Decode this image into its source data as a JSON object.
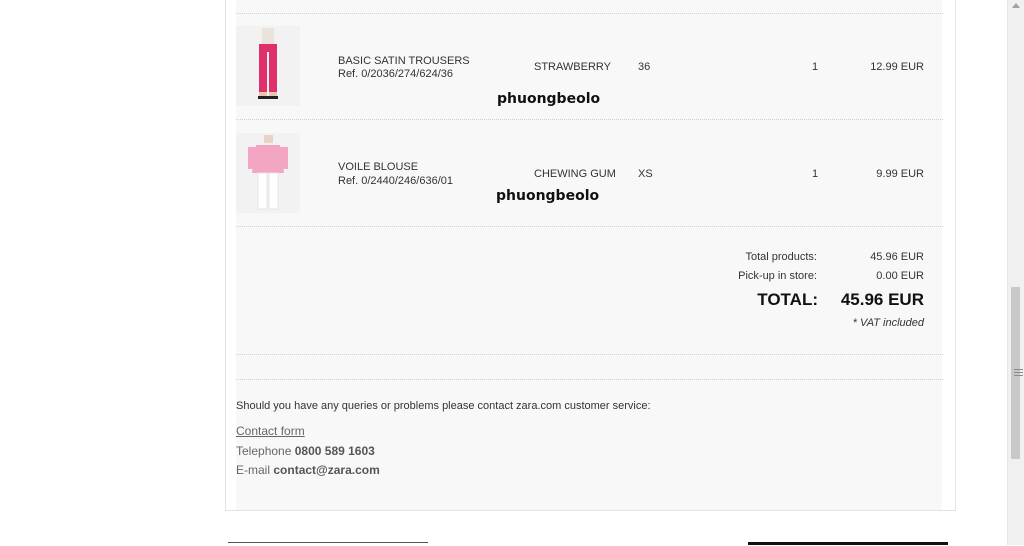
{
  "order": {
    "items": [
      {
        "name": "BASIC SATIN TROUSERS",
        "ref": "Ref. 0/2036/274/624/36",
        "color": "STRAWBERRY",
        "size": "36",
        "quantity": "1",
        "price": "12.99 EUR",
        "watermark": "phuongbeolo",
        "image": "trousers-product-image"
      },
      {
        "name": "VOILE BLOUSE",
        "ref": "Ref. 0/2440/246/636/01",
        "color": "CHEWING GUM",
        "size": "XS",
        "quantity": "1",
        "price": "9.99 EUR",
        "watermark": "phuongbeolo",
        "image": "blouse-product-image"
      }
    ],
    "totals": {
      "products_label": "Total products:",
      "products_value": "45.96 EUR",
      "pickup_label": "Pick-up in store:",
      "pickup_value": "0.00 EUR",
      "total_label": "TOTAL:",
      "total_value": "45.96 EUR",
      "vat_note": "* VAT included"
    }
  },
  "contact": {
    "intro": "Should you have any queries or problems please contact zara.com customer service:",
    "form_link": "Contact form",
    "telephone_label": "Telephone",
    "telephone_value": "0800 589 1603",
    "email_label": "E-mail",
    "email_value": "contact@zara.com"
  },
  "colors": {
    "trousers": "#e0306a",
    "blouse": "#f3a6c4",
    "panel_bg": "#f8f8f8"
  }
}
